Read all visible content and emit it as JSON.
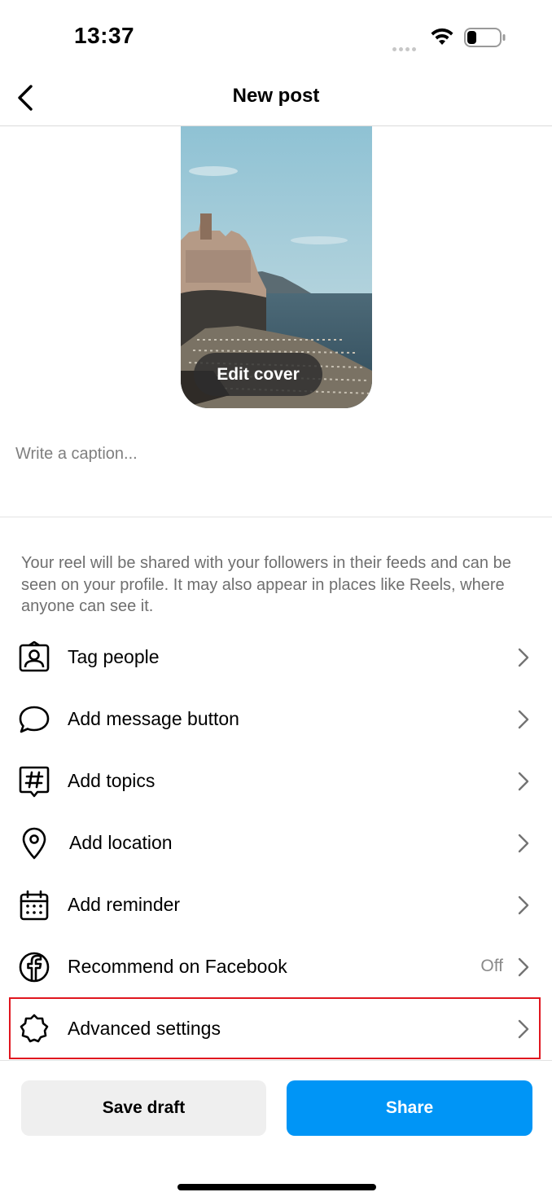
{
  "status_bar": {
    "time": "13:37"
  },
  "header": {
    "title": "New post"
  },
  "cover": {
    "edit_label": "Edit cover"
  },
  "caption": {
    "placeholder": "Write a caption..."
  },
  "notice": "Your reel will be shared with your followers in their feeds and can be seen on your profile. It may also appear in places like Reels, where anyone can see it.",
  "menu": [
    {
      "label": "Tag people",
      "icon": "tag-people-icon"
    },
    {
      "label": "Add message button",
      "icon": "message-bubble-icon"
    },
    {
      "label": "Add topics",
      "icon": "hashtag-icon"
    },
    {
      "label": "Add location",
      "icon": "location-pin-icon"
    },
    {
      "label": "Add reminder",
      "icon": "calendar-icon"
    },
    {
      "label": "Recommend on Facebook",
      "icon": "facebook-icon",
      "value": "Off"
    },
    {
      "label": "Advanced settings",
      "icon": "gear-icon"
    }
  ],
  "footer": {
    "save_draft": "Save draft",
    "share": "Share"
  },
  "colors": {
    "accent": "#0095f6",
    "highlight": "#e0161f"
  }
}
